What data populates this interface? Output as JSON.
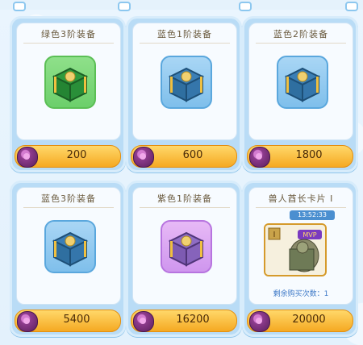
{
  "shop": {
    "items": [
      {
        "title": "绿色3阶装备",
        "price": "200",
        "theme": "green"
      },
      {
        "title": "蓝色1阶装备",
        "price": "600",
        "theme": "blue"
      },
      {
        "title": "蓝色2阶装备",
        "price": "1800",
        "theme": "blue"
      },
      {
        "title": "蓝色3阶装备",
        "price": "5400",
        "theme": "blue"
      },
      {
        "title": "紫色1阶装备",
        "price": "16200",
        "theme": "purple"
      },
      {
        "title": "兽人酋长卡片 I",
        "price": "20000",
        "timer": "13:52:33",
        "badge": "MVP",
        "remaining": "剩余购买次数：1"
      }
    ]
  },
  "colors": {
    "green_box": "#2f9b3e",
    "blue_box": "#2f6fa0",
    "purple_box": "#7d5bb2",
    "price_bar": "#f5a922"
  }
}
